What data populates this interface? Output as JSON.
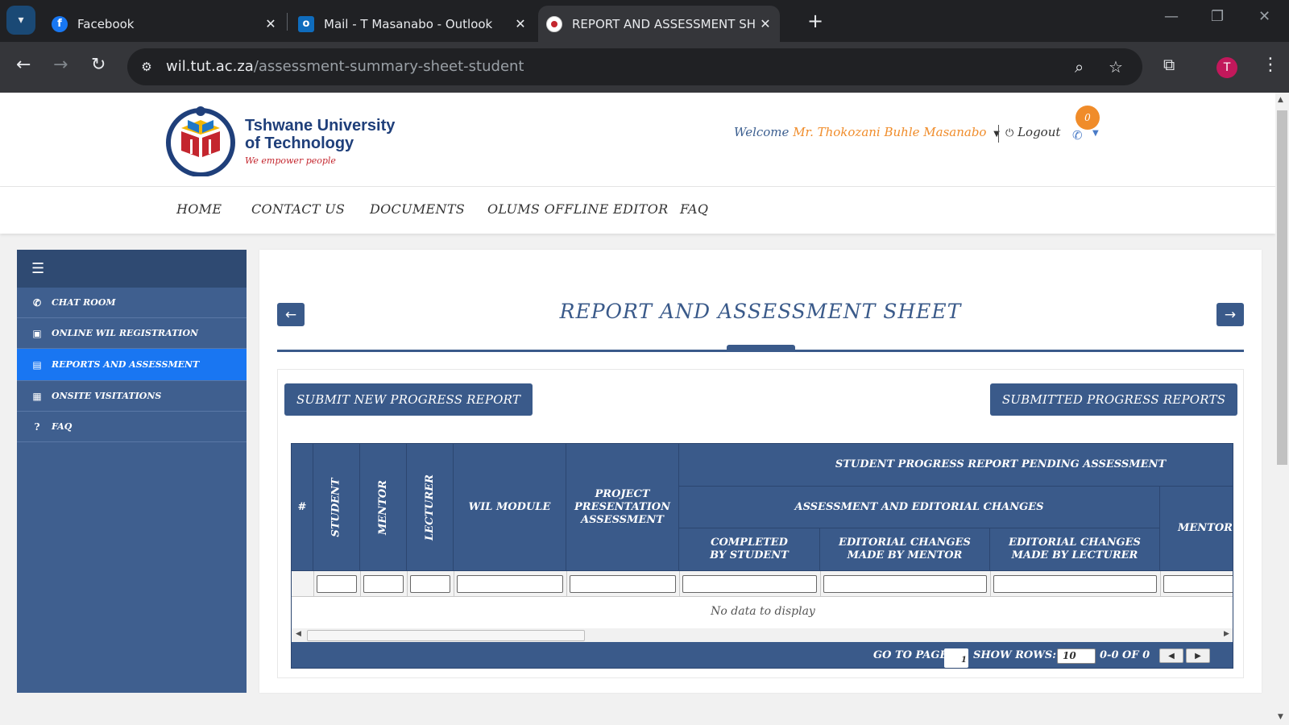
{
  "browser": {
    "tabs": [
      {
        "title": "Facebook",
        "icon": "facebook-icon",
        "color": "#1877f2"
      },
      {
        "title": "Mail - T Masanabo - Outlook",
        "icon": "outlook-icon",
        "color": "#0f6cbd"
      },
      {
        "title": "REPORT AND ASSESSMENT SHEET",
        "icon": "tut-favicon",
        "color": "#ffffff"
      }
    ],
    "url_host": "wil.tut.ac.za",
    "url_path": "/assessment-summary-sheet-student",
    "profile_initial": "T"
  },
  "header": {
    "logo_line1": "Tshwane University",
    "logo_line2": "of Technology",
    "logo_tagline": "We empower people",
    "welcome": "Welcome",
    "user_name": "Mr. Thokozani Buhle Masanabo",
    "logout": "Logout",
    "notification_count": "0"
  },
  "nav": [
    "HOME",
    "CONTACT US",
    "DOCUMENTS",
    "OLUMS OFFLINE EDITOR",
    "FAQ"
  ],
  "sidebar": {
    "items": [
      {
        "label": "CHAT ROOM",
        "icon": "whatsapp-icon"
      },
      {
        "label": "ONLINE WIL REGISTRATION",
        "icon": "id-badge-icon"
      },
      {
        "label": "REPORTS AND ASSESSMENT",
        "icon": "document-icon",
        "active": true
      },
      {
        "label": "ONSITE VISITATIONS",
        "icon": "calendar-check-icon"
      },
      {
        "label": "FAQ",
        "icon": "question-icon"
      }
    ]
  },
  "main": {
    "title": "REPORT AND ASSESSMENT SHEET",
    "submit_button": "SUBMIT NEW PROGRESS REPORT",
    "submitted_button": "SUBMITTED PROGRESS REPORTS"
  },
  "grid": {
    "headers": {
      "num": "#",
      "student": "STUDENT",
      "mentor": "MENTOR",
      "lecturer": "LECTURER",
      "wil_module": "WIL MODULE",
      "project": "PROJECT PRESENTATION ASSESSMENT",
      "pending": "STUDENT PROGRESS REPORT PENDING ASSESSMENT",
      "assessment_changes": "ASSESSMENT AND EDITORIAL CHANGES",
      "completed": "COMPLETED BY STUDENT",
      "edit_mentor": "EDITORIAL CHANGES MADE BY MENTOR",
      "edit_lecturer": "EDITORIAL CHANGES MADE BY LECTURER",
      "mentor_col": "MENTOR"
    },
    "no_data": "No data to display",
    "pager": {
      "go_to_page": "GO TO PAGE:",
      "page_value": "1",
      "show_rows": "SHOW ROWS:",
      "rows_value": "10",
      "range": "0-0 OF 0"
    }
  },
  "colors": {
    "primary": "#3a5a8a",
    "sidebar_active": "#1976f2",
    "accent_orange": "#f08c2a"
  }
}
